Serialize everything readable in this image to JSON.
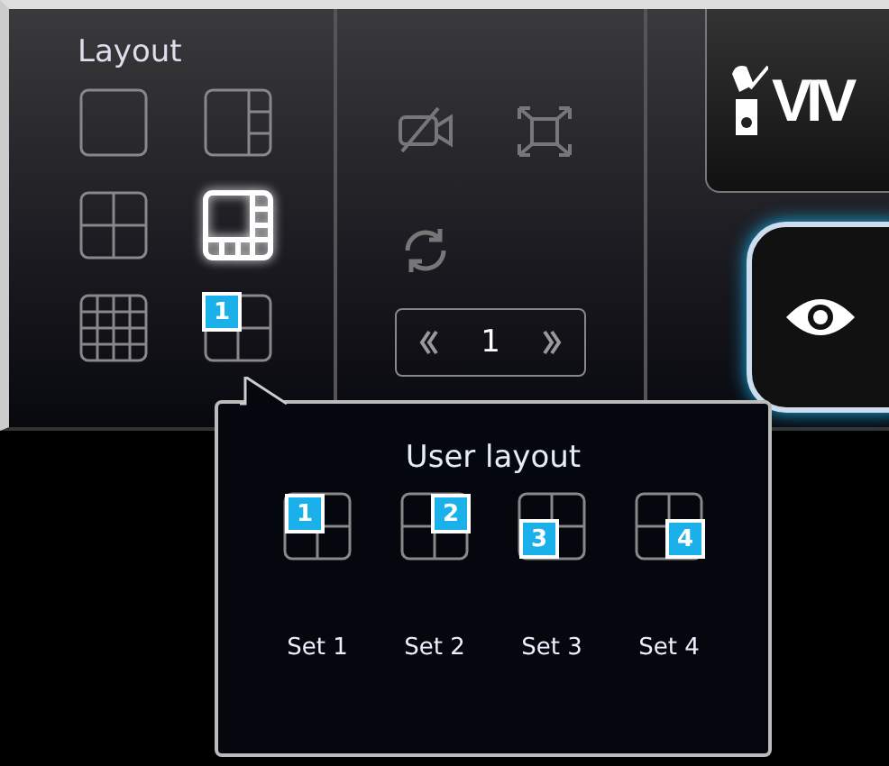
{
  "layout_panel": {
    "title": "Layout",
    "options": [
      {
        "kind": "single",
        "selected": false
      },
      {
        "kind": "one-plus-three",
        "selected": false
      },
      {
        "kind": "quad",
        "selected": false
      },
      {
        "kind": "one-plus-seven",
        "selected": true
      },
      {
        "kind": "grid-16",
        "selected": false
      },
      {
        "kind": "user",
        "badge": "1",
        "selected": false
      }
    ]
  },
  "controls": {
    "page_number": "1"
  },
  "logo": {
    "text": "VIV"
  },
  "popup": {
    "title": "User layout",
    "sets": [
      {
        "badge": "1",
        "label": "Set 1"
      },
      {
        "badge": "2",
        "label": "Set 2"
      },
      {
        "badge": "3",
        "label": "Set 3"
      },
      {
        "badge": "4",
        "label": "Set 4"
      }
    ]
  }
}
